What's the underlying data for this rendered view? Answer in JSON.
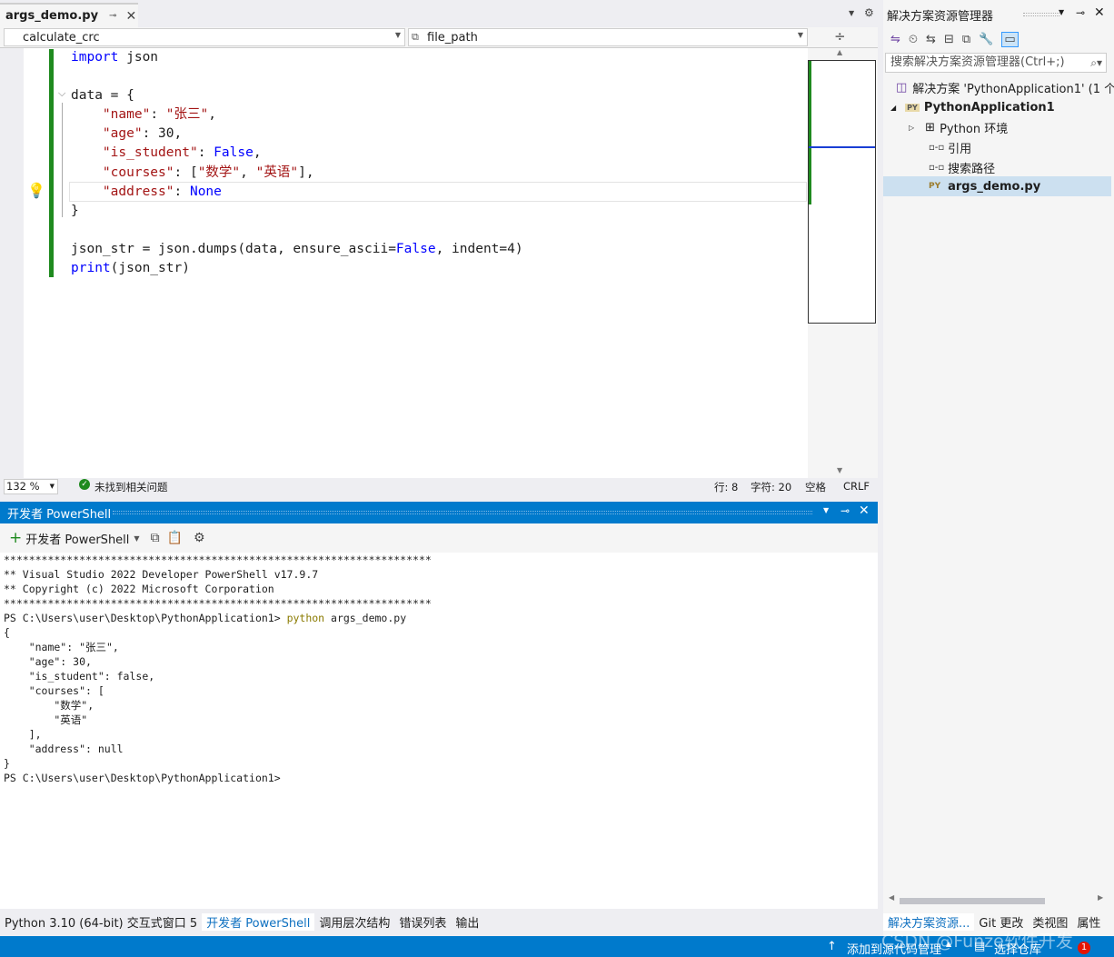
{
  "editor": {
    "tab_title": "args_demo.py",
    "nav_left": "calculate_crc",
    "nav_right": "file_path",
    "code_lines": [
      {
        "parts": [
          {
            "t": "import",
            "c": "kw"
          },
          {
            "t": " json",
            "c": ""
          }
        ]
      },
      {
        "parts": [
          {
            "t": "",
            "c": ""
          }
        ]
      },
      {
        "parts": [
          {
            "t": "data = {",
            "c": ""
          }
        ]
      },
      {
        "parts": [
          {
            "t": "    ",
            "c": ""
          },
          {
            "t": "\"name\"",
            "c": "str"
          },
          {
            "t": ": ",
            "c": ""
          },
          {
            "t": "\"张三\"",
            "c": "str"
          },
          {
            "t": ",",
            "c": ""
          }
        ]
      },
      {
        "parts": [
          {
            "t": "    ",
            "c": ""
          },
          {
            "t": "\"age\"",
            "c": "str"
          },
          {
            "t": ": 30,",
            "c": ""
          }
        ]
      },
      {
        "parts": [
          {
            "t": "    ",
            "c": ""
          },
          {
            "t": "\"is_student\"",
            "c": "str"
          },
          {
            "t": ": ",
            "c": ""
          },
          {
            "t": "False",
            "c": "kw"
          },
          {
            "t": ",",
            "c": ""
          }
        ]
      },
      {
        "parts": [
          {
            "t": "    ",
            "c": ""
          },
          {
            "t": "\"courses\"",
            "c": "str"
          },
          {
            "t": ": [",
            "c": ""
          },
          {
            "t": "\"数学\"",
            "c": "str"
          },
          {
            "t": ", ",
            "c": ""
          },
          {
            "t": "\"英语\"",
            "c": "str"
          },
          {
            "t": "],",
            "c": ""
          }
        ]
      },
      {
        "parts": [
          {
            "t": "    ",
            "c": ""
          },
          {
            "t": "\"address\"",
            "c": "str"
          },
          {
            "t": ": ",
            "c": ""
          },
          {
            "t": "None",
            "c": "kw"
          }
        ]
      },
      {
        "parts": [
          {
            "t": "}",
            "c": ""
          }
        ]
      },
      {
        "parts": [
          {
            "t": "",
            "c": ""
          }
        ]
      },
      {
        "parts": [
          {
            "t": "json_str = json.dumps(data, ensure_ascii=",
            "c": ""
          },
          {
            "t": "False",
            "c": "kw"
          },
          {
            "t": ", indent=4)",
            "c": ""
          }
        ]
      },
      {
        "parts": [
          {
            "t": "print",
            "c": "kw"
          },
          {
            "t": "(json_str)",
            "c": ""
          }
        ]
      }
    ],
    "zoom": "132 %",
    "issues": "未找到相关问题",
    "line": "行: 8",
    "char": "字符: 20",
    "whitespace": "空格",
    "line_ending": "CRLF"
  },
  "terminal": {
    "panel_title": "开发者 PowerShell",
    "new_button": "开发者 PowerShell",
    "lines": [
      "********************************************************************",
      "** Visual Studio 2022 Developer PowerShell v17.9.7",
      "** Copyright (c) 2022 Microsoft Corporation",
      "********************************************************************"
    ],
    "prompt": "PS C:\\Users\\user\\Desktop\\PythonApplication1> ",
    "command_exe": "python",
    "command_arg": " args_demo.py",
    "output": [
      "{",
      "    \"name\": \"张三\",",
      "    \"age\": 30,",
      "    \"is_student\": false,",
      "    \"courses\": [",
      "        \"数学\",",
      "        \"英语\"",
      "    ],",
      "    \"address\": null",
      "}"
    ],
    "final_prompt": "PS C:\\Users\\user\\Desktop\\PythonApplication1>"
  },
  "bottom_tabs": [
    "Python 3.10 (64-bit) 交互式窗口 5",
    "开发者 PowerShell",
    "调用层次结构",
    "错误列表",
    "输出"
  ],
  "solution_explorer": {
    "title": "解决方案资源管理器",
    "search_placeholder": "搜索解决方案资源管理器(Ctrl+;)",
    "items": [
      {
        "label": "解决方案 'PythonApplication1' (1 个",
        "icon": "solution-icon"
      },
      {
        "label": "PythonApplication1",
        "icon": "python-project-icon"
      },
      {
        "label": "Python 环境",
        "icon": "environment-icon"
      },
      {
        "label": "引用",
        "icon": "reference-icon"
      },
      {
        "label": "搜索路径",
        "icon": "search-path-icon"
      },
      {
        "label": "args_demo.py",
        "icon": "python-file-icon"
      }
    ],
    "bottom_tabs": [
      "解决方案资源...",
      "Git 更改",
      "类视图",
      "属性"
    ]
  },
  "statusbar": {
    "add_source": "添加到源代码管理",
    "select_repo": "选择仓库",
    "notifications": "1",
    "watermark": "CSDN @Funze软件开发"
  },
  "colors": {
    "accent": "#007acc",
    "green_margin": "#1f8a1f",
    "keyword": "#0000ff",
    "string": "#a31515"
  }
}
